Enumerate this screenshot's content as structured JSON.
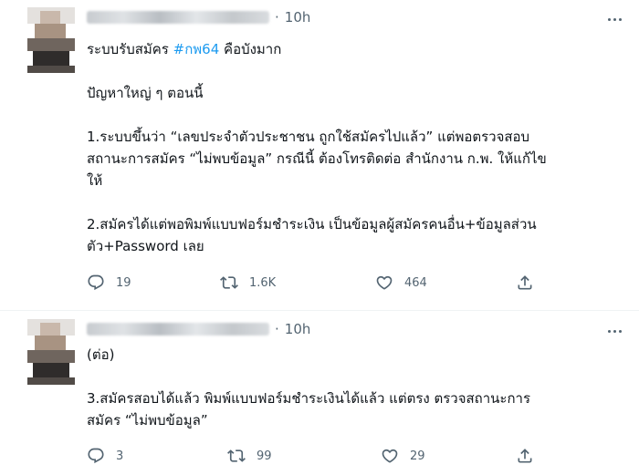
{
  "tweets": [
    {
      "time": "10h",
      "separator": "·",
      "text_prefix": "ระบบรับสมัคร ",
      "hashtag": "#กพ64",
      "text_suffix": " คือบังมาก\n\nปัญหาใหญ่ ๆ ตอนนี้\n\n1.ระบบขึ้นว่า “เลขประจำตัวประชาชน ถูกใช้สมัครไปแล้ว” แต่พอตรวจสอบ\nสถานะการสมัคร “ไม่พบข้อมูล” กรณีนี้ ต้องโทรติดต่อ สำนักงาน ก.พ. ให้แก้ไข\nให้\n\n2.สมัครได้แต่พอพิมพ์แบบฟอร์มชำระเงิน เป็นข้อมูลผู้สมัครคนอื่น+ข้อมูลส่วน\nตัว+Password เลย",
      "replies": "19",
      "retweets": "1.6K",
      "likes": "464"
    },
    {
      "time": "10h",
      "separator": "·",
      "text": "(ต่อ)\n\n3.สมัครสอบได้แล้ว พิมพ์แบบฟอร์มชำระเงินได้แล้ว แต่ตรง ตรวจสถานะการ\nสมัคร “ไม่พบข้อมูล”",
      "replies": "3",
      "retweets": "99",
      "likes": "29"
    }
  ],
  "icons": {
    "reply": "reply-icon",
    "retweet": "retweet-icon",
    "like": "heart-icon",
    "share": "share-icon",
    "more": "more-icon"
  },
  "colors": {
    "text": "#0f1419",
    "muted": "#536471",
    "hashtag": "#1d9bf0",
    "divider": "#eff3f4"
  }
}
